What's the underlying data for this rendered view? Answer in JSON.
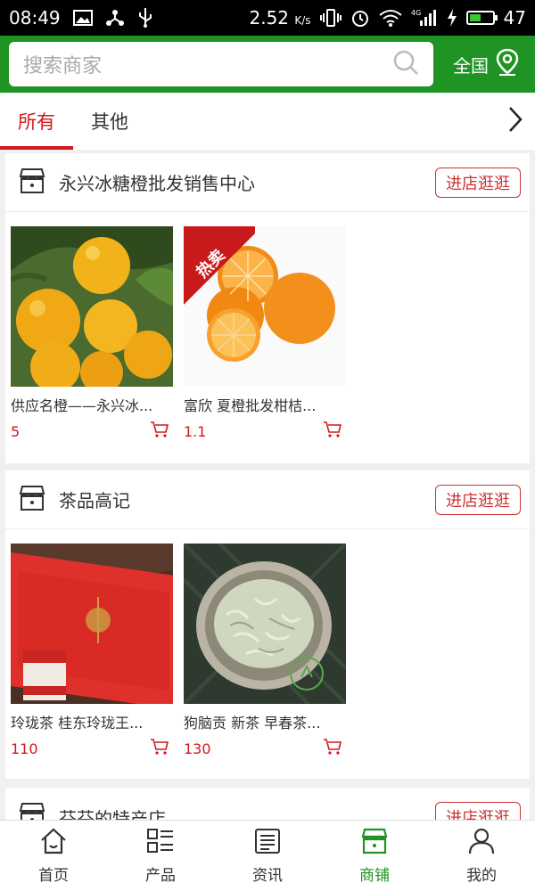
{
  "status_bar": {
    "time": "08:49",
    "speed": "2.52",
    "speed_unit": "K/s",
    "network": "4G",
    "battery": "47",
    "battery_level": 0.47
  },
  "search": {
    "placeholder": "搜索商家"
  },
  "region": {
    "label": "全国"
  },
  "tabs": [
    {
      "label": "所有",
      "active": true
    },
    {
      "label": "其他",
      "active": false
    }
  ],
  "shops": [
    {
      "name": "永兴冰糖橙批发销售中心",
      "visit_label": "进店逛逛",
      "products": [
        {
          "title": "供应名橙——永兴冰...",
          "price": "5"
        },
        {
          "title": "富欣 夏橙批发柑桔...",
          "price": "1.1",
          "badge": "热卖"
        }
      ]
    },
    {
      "name": "茶品高记",
      "visit_label": "进店逛逛",
      "products": [
        {
          "title": "玲珑茶 桂东玲珑王...",
          "price": "110"
        },
        {
          "title": "狗脑贡 新茶 早春茶...",
          "price": "130"
        }
      ]
    },
    {
      "name": "芬芬的特产店",
      "visit_label": "进店逛逛"
    }
  ],
  "bottom_nav": [
    {
      "label": "首页",
      "icon": "home-icon",
      "active": false
    },
    {
      "label": "产品",
      "icon": "product-list-icon",
      "active": false
    },
    {
      "label": "资讯",
      "icon": "news-icon",
      "active": false
    },
    {
      "label": "商铺",
      "icon": "shop-icon",
      "active": true
    },
    {
      "label": "我的",
      "icon": "profile-icon",
      "active": false
    }
  ],
  "colors": {
    "brand_green": "#1f9424",
    "accent_red": "#d1181c"
  }
}
